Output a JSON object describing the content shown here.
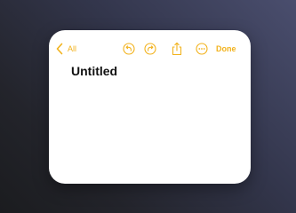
{
  "app": {
    "accent_color": "#f2b21c",
    "background_color": "#ffffff"
  },
  "toolbar": {
    "back_icon": "chevron-left-icon",
    "back_label": "All",
    "undo_icon": "undo-icon",
    "redo_icon": "redo-icon",
    "share_icon": "share-icon",
    "more_icon": "more-icon",
    "done_label": "Done"
  },
  "note": {
    "title": "Untitled",
    "body": ""
  }
}
